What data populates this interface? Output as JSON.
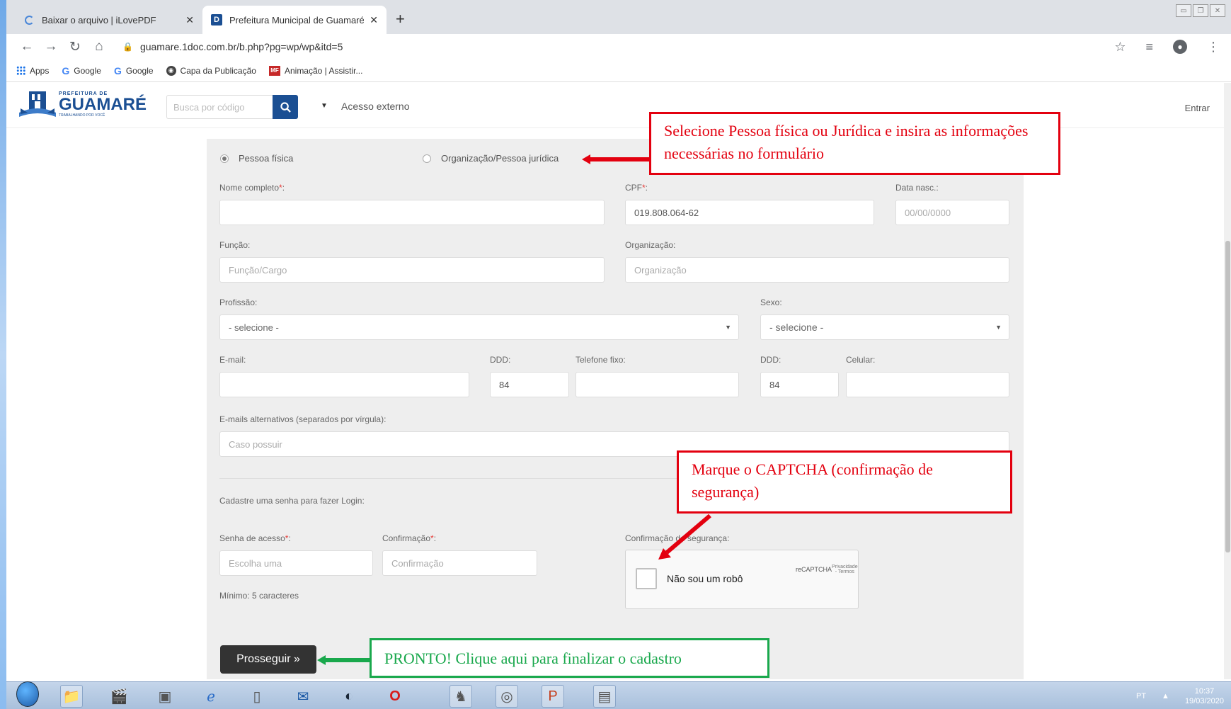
{
  "browser": {
    "tabs": [
      {
        "title": "Baixar o arquivo | iLovePDF",
        "active": false
      },
      {
        "title": "Prefeitura Municipal de Guamaré",
        "active": true
      }
    ],
    "url": "guamare.1doc.com.br/b.php?pg=wp/wp&itd=5",
    "bookmarks": [
      {
        "label": "Apps",
        "icon": "apps-grid-icon"
      },
      {
        "label": "Google",
        "icon": "google-icon"
      },
      {
        "label": "Google",
        "icon": "google-icon"
      },
      {
        "label": "Capa da Publicação",
        "icon": "globe-icon"
      },
      {
        "label": "Animação | Assistir...",
        "icon": "mf-icon"
      }
    ]
  },
  "site": {
    "logo_top": "PREFEITURA DE",
    "logo_name": "GUAMARÉ",
    "logo_tagline": "TRABALHANDO POR VOCÊ",
    "search_placeholder": "Busca por código",
    "external_access": "Acesso externo",
    "login": "Entrar"
  },
  "form": {
    "person_type": [
      {
        "label": "Pessoa física",
        "selected": true
      },
      {
        "label": "Organização/Pessoa jurídica",
        "selected": false
      }
    ],
    "full_name": {
      "label": "Nome completo",
      "required_mark": "*",
      "suffix": ":",
      "value": ""
    },
    "cpf": {
      "label": "CPF",
      "required_mark": "*",
      "suffix": ":",
      "value": "019.808.064-62"
    },
    "birth_date": {
      "label": "Data nasc.:",
      "placeholder": "00/00/0000"
    },
    "function": {
      "label": "Função:",
      "placeholder": "Função/Cargo"
    },
    "organization": {
      "label": "Organização:",
      "placeholder": "Organização"
    },
    "profession": {
      "label": "Profissão:",
      "selected": "- selecione -"
    },
    "sex": {
      "label": "Sexo:",
      "selected": "- selecione -"
    },
    "email": {
      "label": "E-mail:",
      "value": ""
    },
    "ddd_fixed": {
      "label": "DDD:",
      "value": "84"
    },
    "phone_fixed": {
      "label": "Telefone fixo:",
      "value": ""
    },
    "ddd_mobile": {
      "label": "DDD:",
      "value": "84"
    },
    "mobile": {
      "label": "Celular:",
      "value": ""
    },
    "alt_emails": {
      "label": "E-mails alternativos (separados por vírgula):",
      "placeholder": "Caso possuir"
    },
    "password_section": "Cadastre uma senha para fazer Login:",
    "password": {
      "label": "Senha de acesso",
      "required_mark": "*",
      "suffix": ":",
      "placeholder": "Escolha uma"
    },
    "confirm": {
      "label": "Confirmação",
      "required_mark": "*",
      "suffix": ":",
      "placeholder": "Confirmação"
    },
    "security_label": "Confirmação de segurança:",
    "min_chars": "Mínimo: 5 caracteres",
    "captcha": {
      "text": "Não sou um robô",
      "brand": "reCAPTCHA",
      "links": "Privacidade - Termos"
    },
    "submit": "Prosseguir »"
  },
  "annotations": {
    "person_type_note": "Selecione Pessoa física ou  Jurídica e insira as informações necessárias no formulário",
    "captcha_note": "Marque o CAPTCHA (confirmação de segurança)",
    "submit_note": "PRONTO! Clique aqui para finalizar o cadastro",
    "colors": {
      "red": "#e3000f",
      "green": "#19a84c"
    }
  },
  "taskbar": {
    "lang": "PT",
    "time": "10:37",
    "date": "19/03/2020",
    "apps": [
      "start-orb-icon",
      "file-explorer-icon",
      "video-editor-icon",
      "media-player-icon",
      "internet-explorer-icon",
      "blank-document-icon",
      "email-icon",
      "steam-icon",
      "opera-icon",
      "game-icon",
      "chrome-icon",
      "powerpoint-icon",
      "presentation-window-icon"
    ]
  }
}
